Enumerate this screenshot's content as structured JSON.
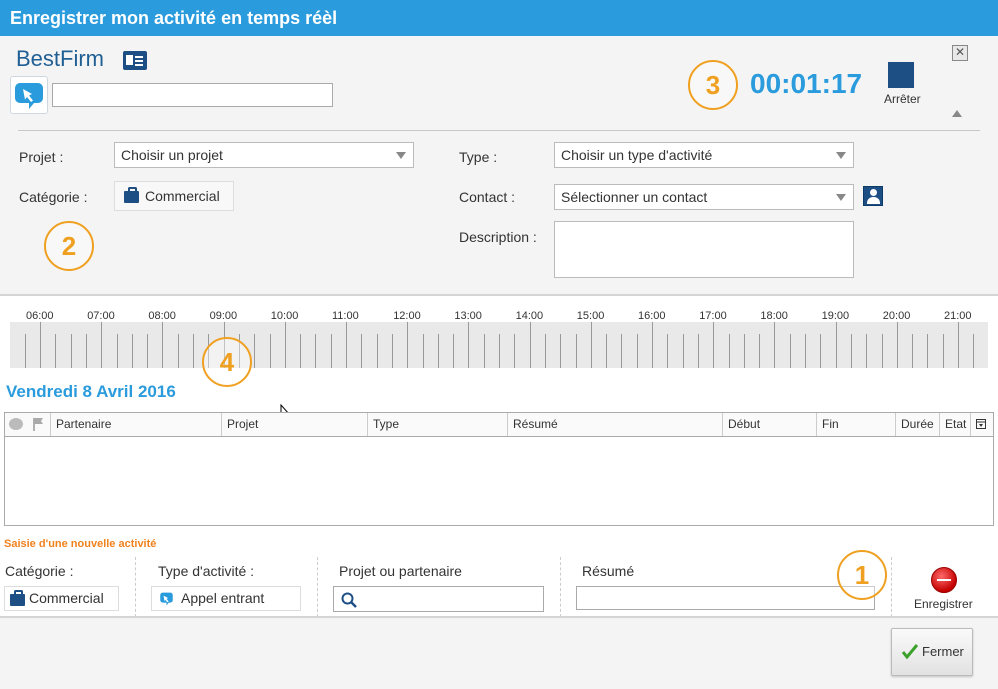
{
  "window": {
    "title": "Enregistrer mon activité en temps réèl"
  },
  "header": {
    "company": "BestFirm",
    "input_value": "",
    "timer": "00:01:17",
    "stop_label": "Arrêter",
    "close_symbol": "✕"
  },
  "form": {
    "projet_label": "Projet :",
    "projet_value": "Choisir un projet",
    "type_label": "Type :",
    "type_value": "Choisir un type d'activité",
    "categorie_label": "Catégorie :",
    "categorie_value": "Commercial",
    "contact_label": "Contact :",
    "contact_value": "Sélectionner un contact",
    "description_label": "Description :"
  },
  "callouts": [
    "1",
    "2",
    "3",
    "4"
  ],
  "timeline": {
    "hours": [
      "06:00",
      "07:00",
      "08:00",
      "09:00",
      "10:00",
      "11:00",
      "12:00",
      "13:00",
      "14:00",
      "15:00",
      "16:00",
      "17:00",
      "18:00",
      "19:00",
      "20:00",
      "21:00"
    ]
  },
  "day_title": "Vendredi 8 Avril 2016",
  "grid": {
    "columns": [
      "Partenaire",
      "Projet",
      "Type",
      "Résumé",
      "Début",
      "Fin",
      "Durée",
      "Etat"
    ]
  },
  "new_activity": {
    "title": "Saisie d'une nouvelle activité",
    "categorie_label": "Catégorie :",
    "categorie_value": "Commercial",
    "type_label": "Type d'activité :",
    "type_value": "Appel entrant",
    "projet_label": "Projet ou partenaire",
    "resume_label": "Résumé",
    "save_label": "Enregistrer"
  },
  "footer": {
    "close_label": "Fermer"
  },
  "colors": {
    "accent": "#2a9bdc",
    "callout": "#f0a020",
    "navy": "#1e4f84",
    "orange_title": "#f0821e"
  }
}
